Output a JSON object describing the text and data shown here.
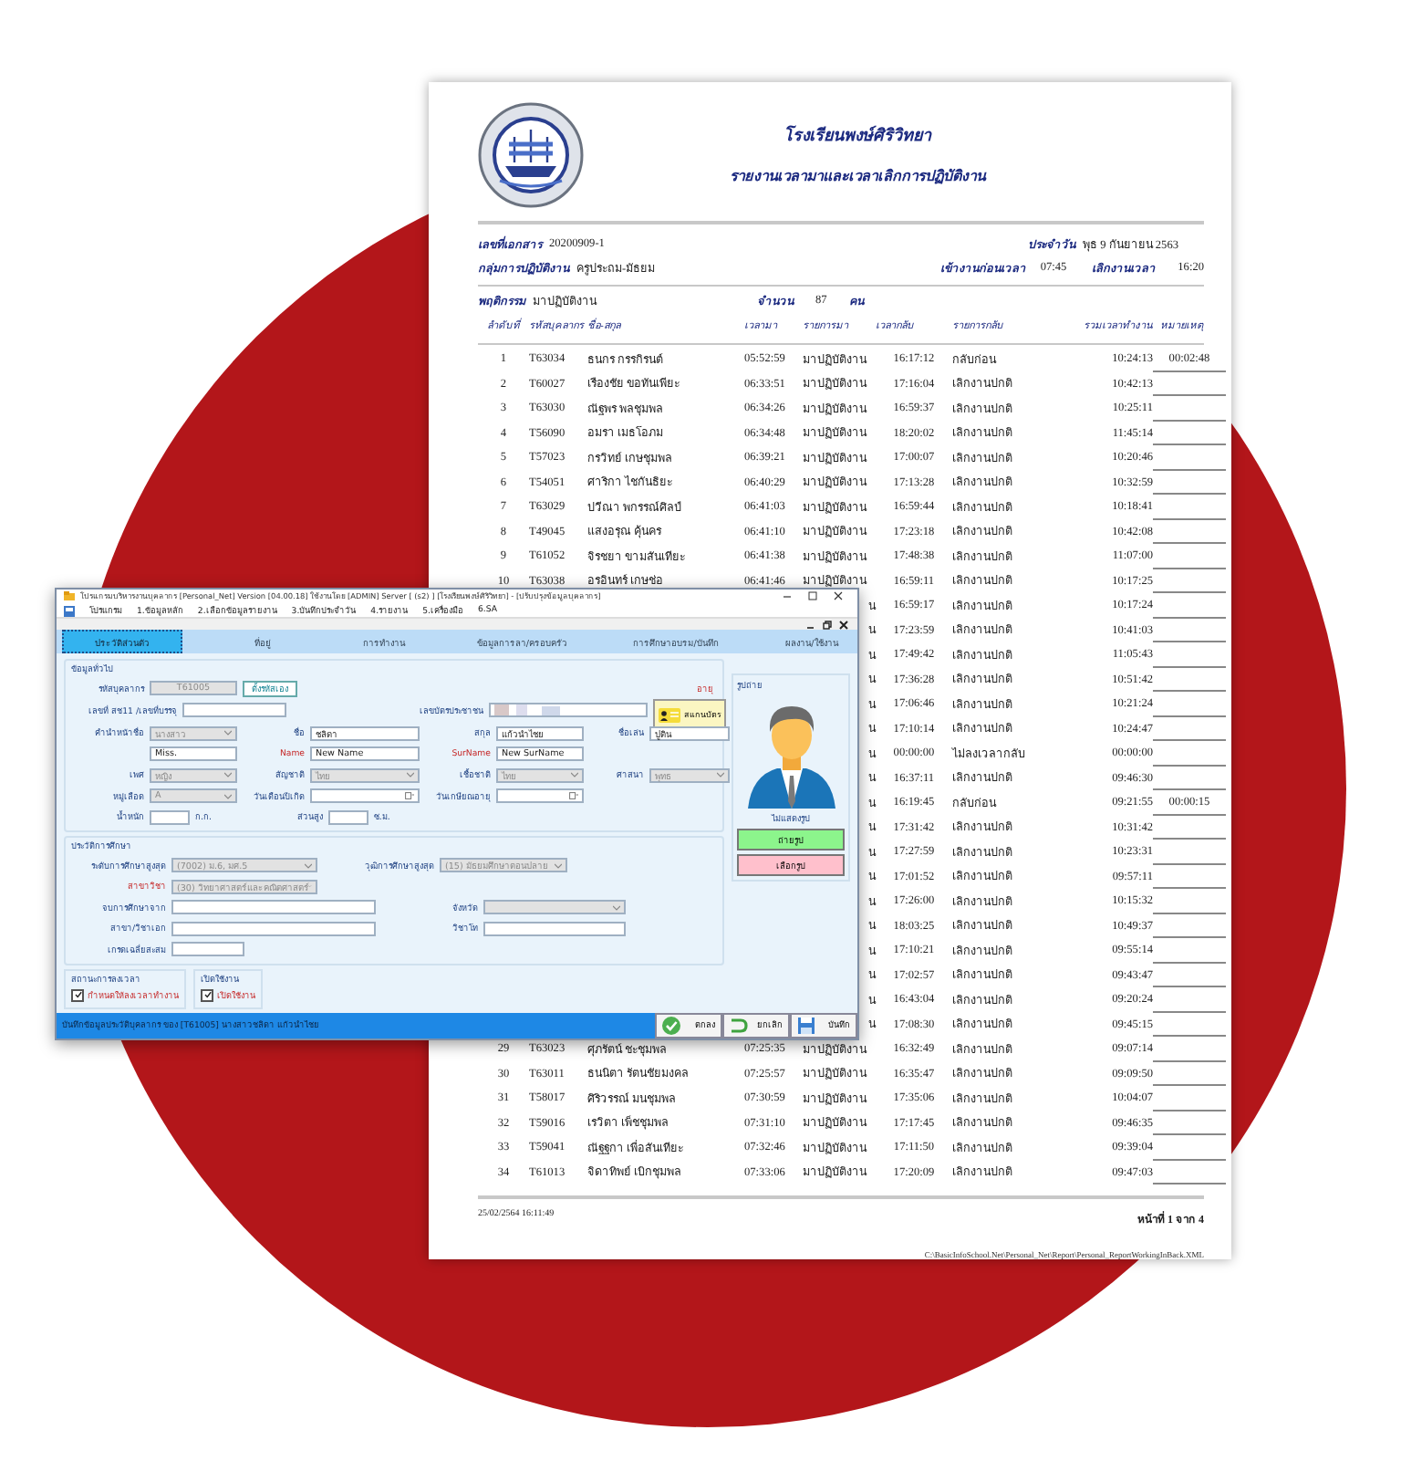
{
  "report": {
    "title": "โรงเรียนพงษ์ศิริวิทยา",
    "subtitle": "รายงานเวลามาและเวลาเลิกการปฏิบัติงาน",
    "doc_no_label": "เลขที่เอกสาร",
    "doc_no": "20200909-1",
    "date_label": "ประจำวัน",
    "date": "พุธ 9 กันยายน 2563",
    "group_label": "กลุ่มการปฏิบัติงาน",
    "group": "ครูประถม-มัธยม",
    "checkin_label": "เข้างานก่อนเวลา",
    "checkin": "07:45",
    "checkout_label": "เลิกงานเวลา",
    "checkout": "16:20",
    "behavior_label": "พฤติกรรม",
    "behavior": "มาปฏิบัติงาน",
    "count_label": "จำนวน",
    "count": "87",
    "count_unit": "คน",
    "columns": [
      "ลำดับที่",
      "รหัสบุคลากร",
      "ชื่อ-สกุล",
      "เวลามา",
      "รายการมา",
      "เวลากลับ",
      "รายการกลับ",
      "รวมเวลาทำงาน",
      "หมายเหตุ"
    ],
    "rows": [
      {
        "kind": "full",
        "no": "1",
        "code": "T63034",
        "name": "ธนกร กรรกิรนต์",
        "time_in": "05:52:59",
        "in_status": "มาปฏิบัติงาน",
        "time_out": "16:17:12",
        "out_status": "กลับก่อน",
        "total": "10:24:13",
        "note": "00:02:48"
      },
      {
        "kind": "full",
        "no": "2",
        "code": "T60027",
        "name": "เรืองชัย ขอทันเพียะ",
        "time_in": "06:33:51",
        "in_status": "มาปฏิบัติงาน",
        "time_out": "17:16:04",
        "out_status": "เลิกงานปกติ",
        "total": "10:42:13"
      },
      {
        "kind": "full",
        "no": "3",
        "code": "T63030",
        "name": "ณัฐพร พลชุมพล",
        "time_in": "06:34:26",
        "in_status": "มาปฏิบัติงาน",
        "time_out": "16:59:37",
        "out_status": "เลิกงานปกติ",
        "total": "10:25:11"
      },
      {
        "kind": "full",
        "no": "4",
        "code": "T56090",
        "name": "อมรา เมธโอภม",
        "time_in": "06:34:48",
        "in_status": "มาปฏิบัติงาน",
        "time_out": "18:20:02",
        "out_status": "เลิกงานปกติ",
        "total": "11:45:14"
      },
      {
        "kind": "full",
        "no": "5",
        "code": "T57023",
        "name": "กรวิทย์ เกษชุมพล",
        "time_in": "06:39:21",
        "in_status": "มาปฏิบัติงาน",
        "time_out": "17:00:07",
        "out_status": "เลิกงานปกติ",
        "total": "10:20:46"
      },
      {
        "kind": "full",
        "no": "6",
        "code": "T54051",
        "name": "ศาริกา ไชกันธิยะ",
        "time_in": "06:40:29",
        "in_status": "มาปฏิบัติงาน",
        "time_out": "17:13:28",
        "out_status": "เลิกงานปกติ",
        "total": "10:32:59"
      },
      {
        "kind": "full",
        "no": "7",
        "code": "T63029",
        "name": "ปวีณา พกรรณ์ศิลป์",
        "time_in": "06:41:03",
        "in_status": "มาปฏิบัติงาน",
        "time_out": "16:59:44",
        "out_status": "เลิกงานปกติ",
        "total": "10:18:41"
      },
      {
        "kind": "full",
        "no": "8",
        "code": "T49045",
        "name": "แสงอรุณ คุ้นคร",
        "time_in": "06:41:10",
        "in_status": "มาปฏิบัติงาน",
        "time_out": "17:23:18",
        "out_status": "เลิกงานปกติ",
        "total": "10:42:08"
      },
      {
        "kind": "full",
        "no": "9",
        "code": "T61052",
        "name": "จิรชยา ขามสันเทียะ",
        "time_in": "06:41:38",
        "in_status": "มาปฏิบัติงาน",
        "time_out": "17:48:38",
        "out_status": "เลิกงานปกติ",
        "total": "11:07:00"
      },
      {
        "kind": "full",
        "no": "10",
        "code": "T63038",
        "name": "อรอินทร์ เกษช่อ",
        "time_in": "06:41:46",
        "in_status": "มาปฏิบัติงาน",
        "time_out": "16:59:11",
        "out_status": "เลิกงานปกติ",
        "total": "10:17:25"
      },
      {
        "kind": "covered",
        "in_status": "น",
        "time_out": "16:59:17",
        "out_status": "เลิกงานปกติ",
        "total": "10:17:24"
      },
      {
        "kind": "covered",
        "in_status": "น",
        "time_out": "17:23:59",
        "out_status": "เลิกงานปกติ",
        "total": "10:41:03"
      },
      {
        "kind": "covered",
        "in_status": "น",
        "time_out": "17:49:42",
        "out_status": "เลิกงานปกติ",
        "total": "11:05:43"
      },
      {
        "kind": "covered",
        "in_status": "น",
        "time_out": "17:36:28",
        "out_status": "เลิกงานปกติ",
        "total": "10:51:42"
      },
      {
        "kind": "covered",
        "in_status": "น",
        "time_out": "17:06:46",
        "out_status": "เลิกงานปกติ",
        "total": "10:21:24"
      },
      {
        "kind": "covered",
        "in_status": "น",
        "time_out": "17:10:14",
        "out_status": "เลิกงานปกติ",
        "total": "10:24:47"
      },
      {
        "kind": "covered",
        "in_status": "น",
        "time_out": "00:00:00",
        "out_status": "ไม่ลงเวลากลับ",
        "total": "00:00:00"
      },
      {
        "kind": "covered",
        "in_status": "น",
        "time_out": "16:37:11",
        "out_status": "เลิกงานปกติ",
        "total": "09:46:30"
      },
      {
        "kind": "covered",
        "in_status": "น",
        "time_out": "16:19:45",
        "out_status": "กลับก่อน",
        "total": "09:21:55",
        "note": "00:00:15"
      },
      {
        "kind": "covered",
        "in_status": "น",
        "time_out": "17:31:42",
        "out_status": "เลิกงานปกติ",
        "total": "10:31:42"
      },
      {
        "kind": "covered",
        "in_status": "น",
        "time_out": "17:27:59",
        "out_status": "เลิกงานปกติ",
        "total": "10:23:31"
      },
      {
        "kind": "covered",
        "in_status": "น",
        "time_out": "17:01:52",
        "out_status": "เลิกงานปกติ",
        "total": "09:57:11"
      },
      {
        "kind": "covered",
        "in_status": "น",
        "time_out": "17:26:00",
        "out_status": "เลิกงานปกติ",
        "total": "10:15:32"
      },
      {
        "kind": "covered",
        "in_status": "น",
        "time_out": "18:03:25",
        "out_status": "เลิกงานปกติ",
        "total": "10:49:37"
      },
      {
        "kind": "covered",
        "in_status": "น",
        "time_out": "17:10:21",
        "out_status": "เลิกงานปกติ",
        "total": "09:55:14"
      },
      {
        "kind": "covered",
        "in_status": "น",
        "time_out": "17:02:57",
        "out_status": "เลิกงานปกติ",
        "total": "09:43:47"
      },
      {
        "kind": "covered",
        "in_status": "น",
        "time_out": "16:43:04",
        "out_status": "เลิกงานปกติ",
        "total": "09:20:24"
      },
      {
        "kind": "covered",
        "in_status": "น",
        "time_out": "17:08:30",
        "out_status": "เลิกงานปกติ",
        "total": "09:45:15"
      },
      {
        "kind": "full",
        "no": "29",
        "code": "T63023",
        "name": "ศุภรัตน์ ชะชุมพล",
        "time_in": "07:25:35",
        "in_status": "มาปฏิบัติงาน",
        "time_out": "16:32:49",
        "out_status": "เลิกงานปกติ",
        "total": "09:07:14"
      },
      {
        "kind": "full",
        "no": "30",
        "code": "T63011",
        "name": "ธนนิตา รัตนชัยมงคล",
        "time_in": "07:25:57",
        "in_status": "มาปฏิบัติงาน",
        "time_out": "16:35:47",
        "out_status": "เลิกงานปกติ",
        "total": "09:09:50"
      },
      {
        "kind": "full",
        "no": "31",
        "code": "T58017",
        "name": "ศิริวรรณ์ มนชุมพล",
        "time_in": "07:30:59",
        "in_status": "มาปฏิบัติงาน",
        "time_out": "17:35:06",
        "out_status": "เลิกงานปกติ",
        "total": "10:04:07"
      },
      {
        "kind": "full",
        "no": "32",
        "code": "T59016",
        "name": "เรวิตา เพ็ชชุมพล",
        "time_in": "07:31:10",
        "in_status": "มาปฏิบัติงาน",
        "time_out": "17:17:45",
        "out_status": "เลิกงานปกติ",
        "total": "09:46:35"
      },
      {
        "kind": "full",
        "no": "33",
        "code": "T59041",
        "name": "ณัฐฐกา เพื่อสันเทียะ",
        "time_in": "07:32:46",
        "in_status": "มาปฏิบัติงาน",
        "time_out": "17:11:50",
        "out_status": "เลิกงานปกติ",
        "total": "09:39:04"
      },
      {
        "kind": "full",
        "no": "34",
        "code": "T61013",
        "name": "จิดาทิพย์ เบิกชุมพล",
        "time_in": "07:33:06",
        "in_status": "มาปฏิบัติงาน",
        "time_out": "17:20:09",
        "out_status": "เลิกงานปกติ",
        "total": "09:47:03"
      }
    ],
    "printed_at": "25/02/2564 16:11:49",
    "page": "หน้าที่ 1 จาก 4",
    "file_path": "C:\\BasicInfoSchool.Net\\Personal_Net\\Report\\Personal_ReportWorkingInBack.XML"
  },
  "app_window": {
    "title": "โปรแกรมบริหารงานบุคลากร [Personal_Net] Version [04.00.18] ใช้งานโดย [ADMIN] Server [ (s2) ]  [โรงเรียนพงษ์ศิริวิทยา] - [ปรับปรุงข้อมูลบุคลากร]",
    "menu": [
      "โปรแกรม",
      "1.ข้อมูลหลัก",
      "2.เลือกข้อมูลรายงาน",
      "3.บันทึกประจำวัน",
      "4.รายงาน",
      "5.เครื่องมือ",
      "6.SA"
    ],
    "tabs": [
      {
        "label": "ประวัติส่วนตัว",
        "selected": true
      },
      {
        "label": "ที่อยู่",
        "selected": false
      },
      {
        "label": "การทำงาน",
        "selected": false
      },
      {
        "label": "ข้อมูลการลา/ครอบครัว",
        "selected": false
      },
      {
        "label": "การศึกษาอบรม/บันทึก",
        "selected": false
      },
      {
        "label": "ผลงาน/ใช้งาน",
        "selected": false
      }
    ],
    "general": {
      "title": "ข้อมูลทั่วไป",
      "age_label": "อายุ",
      "rows": [
        [
          {
            "label": "รหัสบุคลากร",
            "value": "T61005",
            "kind": "disabled"
          },
          {
            "value": "ตั้งรหัสเอง",
            "kind": "button"
          }
        ],
        [
          {
            "label": "เลขที่ สช11 /เลขที่บรรจุ",
            "kind": "text"
          },
          {
            "label": "เลขบัตรประชาชน",
            "kind": "blurred"
          },
          {
            "value": "สแกนบัตร",
            "kind": "scan"
          }
        ],
        [
          {
            "label": "คำนำหน้าชื่อ",
            "value": "นางสาว",
            "kind": "select"
          },
          {
            "label": "ชื่อ",
            "value": "ชลิดา",
            "kind": "text"
          },
          {
            "label": "สกุล",
            "value": "แก้วนำไชย",
            "kind": "text"
          },
          {
            "label": "ชื่อเล่น",
            "value": "ปูติน",
            "kind": "text"
          }
        ],
        [
          {
            "value": "Miss.",
            "kind": "text"
          },
          {
            "label": "Name",
            "value": "New Name",
            "kind": "text",
            "highlight": true
          },
          {
            "label": "SurName",
            "value": "New SurName",
            "kind": "text",
            "highlight": true
          }
        ],
        [
          {
            "label": "เพศ",
            "value": "หญิง",
            "kind": "select"
          },
          {
            "label": "สัญชาติ",
            "value": "ไทย",
            "kind": "select"
          },
          {
            "label": "เชื้อชาติ",
            "value": "ไทย",
            "kind": "select"
          },
          {
            "label": "ศาสนา",
            "value": "พุทธ",
            "kind": "select"
          }
        ],
        [
          {
            "label": "หมู่เลือด",
            "value": "A",
            "kind": "select"
          },
          {
            "label": "วันเดือนปีเกิด",
            "kind": "date"
          },
          {
            "label": "วันเกษียณอายุ",
            "kind": "date"
          }
        ],
        [
          {
            "label": "น้ำหนัก",
            "kind": "short",
            "unit": "ก.ก."
          },
          {
            "label": "ส่วนสูง",
            "kind": "short",
            "unit": "ซ.ม."
          }
        ]
      ]
    },
    "education": {
      "title": "ประวัติการศึกษา",
      "rows": [
        [
          {
            "label": "ระดับการศึกษาสูงสุด",
            "value": "(7002) ม.6, มศ.5",
            "kind": "select"
          },
          {
            "label": "วุฒิการศึกษาสูงสุด",
            "value": "(15) มัธยมศึกษาตอนปลาย",
            "kind": "select"
          }
        ],
        [
          {
            "label": "สาขาวิชา",
            "value": "(30) วิทยาศาสตร์และคณิตศาสตร์",
            "kind": "select",
            "highlight": true
          }
        ],
        [
          {
            "label": "จบการศึกษาจาก",
            "kind": "text"
          },
          {
            "label": "จังหวัด",
            "kind": "disabled_select"
          }
        ],
        [
          {
            "label": "สาขา/วิชาเอก",
            "kind": "text"
          },
          {
            "label": "วิชาโท",
            "kind": "text"
          }
        ],
        [
          {
            "label": "เกรดเฉลี่ยสะสม",
            "kind": "short"
          }
        ]
      ]
    },
    "options": [
      {
        "title": "สถานะการลงเวลา",
        "label": "กำหนดให้ลงเวลาทำงาน",
        "checked": true
      },
      {
        "title": "เปิดใช้งาน",
        "label": "เปิดใช้งาน",
        "checked": true
      }
    ],
    "photo": {
      "title": "รูปถ่าย",
      "caption": "ไม่แสดงรูป",
      "buttons": [
        {
          "label": "ถ่ายรูป",
          "kind": "capture"
        },
        {
          "label": "เลือกรูป",
          "kind": "choose"
        }
      ]
    },
    "status": "บันทึกข้อมูลประวัติบุคลากร ของ [T61005] นางสาวชลิดา  แก้วนำไชย",
    "actions": [
      {
        "label": "ตกลง",
        "kind": "ok"
      },
      {
        "label": "ยกเลิก",
        "kind": "cancel"
      },
      {
        "label": "บันทึก",
        "kind": "save"
      }
    ]
  }
}
